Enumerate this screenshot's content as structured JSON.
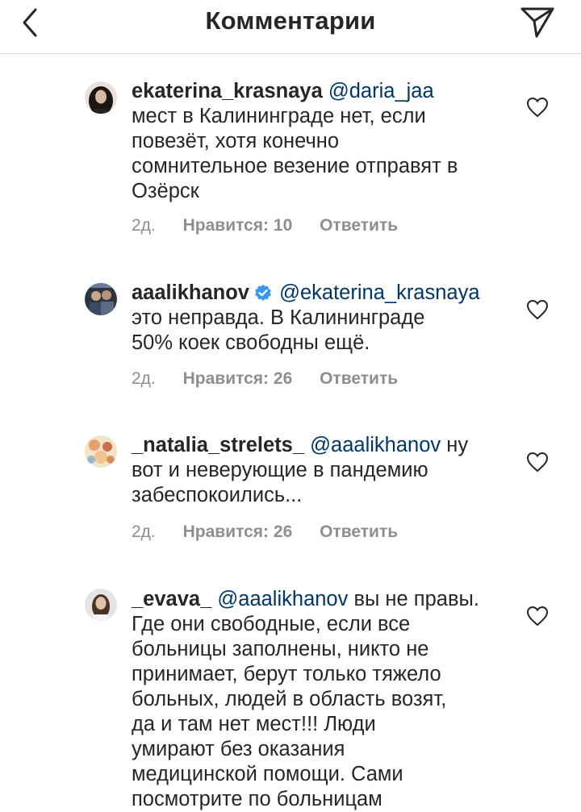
{
  "header": {
    "title": "Комментарии"
  },
  "icons": {
    "back": "chevron-left-icon",
    "share": "paper-plane-icon",
    "like": "heart-outline-icon",
    "verified": "verified-badge-icon"
  },
  "colors": {
    "mention": "#00376b",
    "meta": "#8e8e8e",
    "verified": "#3897f0"
  },
  "comments": [
    {
      "username": "ekaterina_krasnaya",
      "mention": "@daria_jaa",
      "lines": [
        "мест в Калининграде нет, если",
        "повезёт, хотя конечно",
        "сомнительное везение отправят в",
        "Озёрск"
      ],
      "time": "2д.",
      "likes": "Нравится: 10",
      "reply": "Ответить"
    },
    {
      "username": "aaalikhanov",
      "verified": true,
      "mention": "@ekaterina_krasnaya",
      "lines": [
        "это неправда. В Калининграде",
        "50% коек свободны ещё."
      ],
      "time": "2д.",
      "likes": "Нравится: 26",
      "reply": "Ответить"
    },
    {
      "username": "_natalia_strelets_",
      "mention": "@aaalikhanov",
      "first_tail": "ну",
      "lines": [
        "вот и неверующие в пандемию",
        "забеспокоились..."
      ],
      "time": "2д.",
      "likes": "Нравится: 26",
      "reply": "Ответить"
    },
    {
      "username": "_evava_",
      "mention": "@aaalikhanov",
      "first_tail": "вы не правы.",
      "lines": [
        "Где они свободные, если все",
        "больницы заполнены, никто не",
        "принимает, берут только тяжело",
        "больных, людей в область возят,",
        "да и там нет мест!!! Люди",
        "умирают без оказания",
        "медицинской помощи. Сами",
        "посмотрите по больницам"
      ]
    }
  ]
}
